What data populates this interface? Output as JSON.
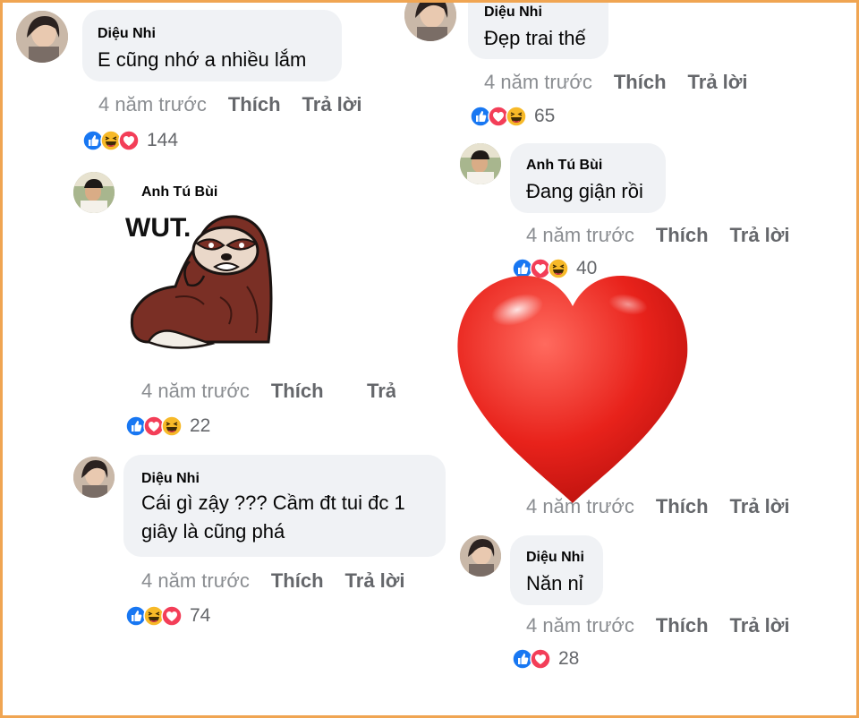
{
  "comments": [
    {
      "name": "Diệu Nhi",
      "text": "E cũng nhớ a nhiều lắm",
      "time": "4 năm trước",
      "like": "Thích",
      "reply": "Trả lời",
      "count": "144",
      "reactions": [
        "like-icon",
        "haha-icon",
        "love-icon"
      ]
    },
    {
      "name": "Anh Tú Bùi",
      "sticker_text": "WUT.",
      "time": "4 năm trước",
      "like": "Thích",
      "reply": "Trả lời",
      "reply_visible": "Trả",
      "count": "22",
      "reactions": [
        "like-icon",
        "love-icon",
        "haha-icon"
      ]
    },
    {
      "name": "Diệu Nhi",
      "text_line1": "Cái gì zậy ??? Cầm đt tui đc 1",
      "text_line2": "giây là cũng phá",
      "time": "4 năm trước",
      "like": "Thích",
      "reply": "Trả lời",
      "count": "74",
      "reactions": [
        "like-icon",
        "haha-icon",
        "love-icon"
      ]
    },
    {
      "name": "Diệu Nhi",
      "text": "Đẹp trai thế",
      "time": "4 năm trước",
      "like": "Thích",
      "reply": "Trả lời",
      "count": "65",
      "reactions": [
        "like-icon",
        "love-icon",
        "haha-icon"
      ]
    },
    {
      "name": "Anh Tú Bùi",
      "text": "Đang giận rồi",
      "time": "4 năm trước",
      "like": "Thích",
      "reply": "Trả lời",
      "count": "40",
      "reactions": [
        "like-icon",
        "love-icon",
        "haha-icon"
      ]
    },
    {
      "time": "4 năm trước",
      "like": "Thích",
      "reply": "Trả lời"
    },
    {
      "name": "Diệu Nhi",
      "text": "Năn nỉ",
      "time": "4 năm trước",
      "like": "Thích",
      "reply": "Trả lời",
      "count": "28",
      "reactions": [
        "like-icon",
        "love-icon"
      ]
    }
  ],
  "colors": {
    "frame": "#f0a552",
    "bubble": "#f0f2f5",
    "like": "#1877f2",
    "love": "#f33e58",
    "haha": "#f7b928",
    "heart": "#e8221b"
  }
}
